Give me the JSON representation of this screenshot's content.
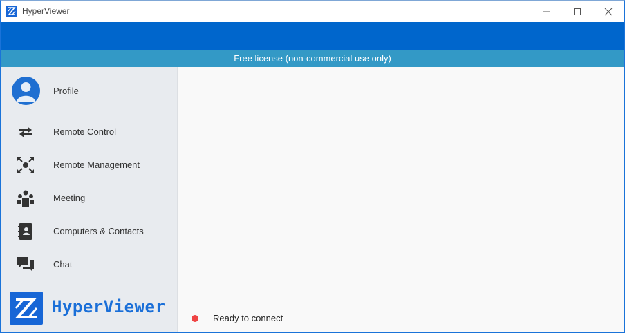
{
  "window": {
    "title": "HyperViewer",
    "controls": [
      "minimize-icon",
      "maximize-icon",
      "close-icon"
    ]
  },
  "license_banner": "Free license (non-commercial use only)",
  "sidebar": {
    "profile": {
      "label": "Profile",
      "icon": "user-avatar-icon"
    },
    "items": [
      {
        "label": "Remote Control",
        "icon": "arrows-swap-icon"
      },
      {
        "label": "Remote Management",
        "icon": "expand-arrows-icon"
      },
      {
        "label": "Meeting",
        "icon": "people-group-icon"
      },
      {
        "label": "Computers & Contacts",
        "icon": "contacts-book-icon"
      },
      {
        "label": "Chat",
        "icon": "chat-bubbles-icon"
      }
    ],
    "brand": "HyperViewer"
  },
  "status": {
    "text": "Ready to connect",
    "dot_color": "#ef4444"
  },
  "colors": {
    "accent": "#0066cc",
    "license_bar": "#3399c6",
    "sidebar_bg": "#e8ebef",
    "brand_blue": "#1766d6"
  }
}
